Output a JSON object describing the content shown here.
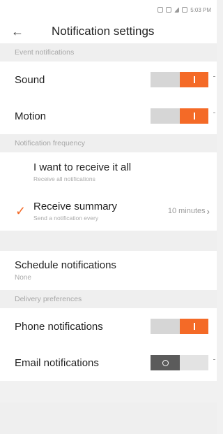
{
  "status_bar": {
    "time": "5:03 PM"
  },
  "header": {
    "back_icon": "arrow-left-icon",
    "title": "Notification settings"
  },
  "sections": {
    "event": {
      "header": "Event notifications",
      "items": [
        {
          "label": "Sound",
          "enabled": true
        },
        {
          "label": "Motion",
          "enabled": true
        }
      ]
    },
    "frequency": {
      "header": "Notification frequency",
      "options": [
        {
          "title": "I want to receive it all",
          "subtitle": "Receive all notifications",
          "selected": false
        },
        {
          "title": "Receive summary",
          "subtitle": "Send a notification every",
          "value": "10 minutes",
          "selected": true
        }
      ]
    },
    "schedule": {
      "title": "Schedule notifications",
      "value": "None"
    },
    "delivery": {
      "header": "Delivery preferences",
      "items": [
        {
          "label": "Phone notifications",
          "enabled": true
        },
        {
          "label": "Email notifications",
          "enabled": false
        }
      ]
    }
  },
  "colors": {
    "accent": "#f46a27",
    "toggle_off": "#5b5b5b",
    "background": "#efefef"
  }
}
